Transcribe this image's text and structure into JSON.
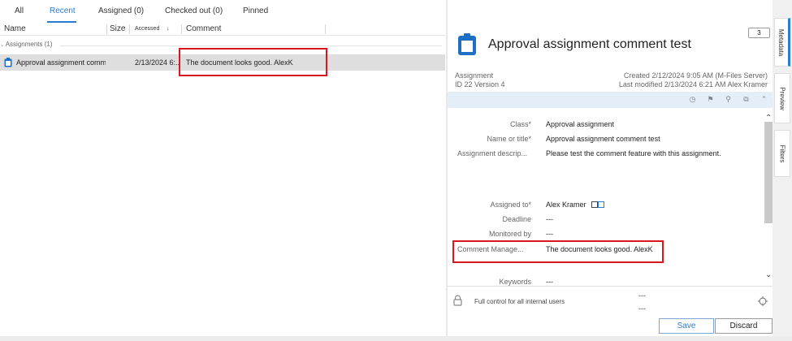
{
  "tabs": [
    {
      "label": "All"
    },
    {
      "label": "Recent"
    },
    {
      "label": "Assigned (0)"
    },
    {
      "label": "Checked out (0)"
    },
    {
      "label": "Pinned"
    }
  ],
  "active_tab": "Recent",
  "columns": {
    "name": "Name",
    "size": "Size",
    "accessed": "Accessed",
    "accessed_sort": "↓",
    "comment": "Comment"
  },
  "group": {
    "label": "Assignments (1)"
  },
  "row": {
    "name": "Approval assignment comm...",
    "accessed": "2/13/2024 6:...",
    "comment": "The document looks good. AlexK"
  },
  "details": {
    "title": "Approval assignment comment test",
    "comment_count": "3",
    "object_type": "Assignment",
    "id_version": "ID 22  Version 4",
    "created": "Created 2/12/2024 9:05 AM (M-Files Server)",
    "last_modified": "Last modified 2/13/2024 6:21 AM Alex Kramer",
    "properties": [
      {
        "label": "Class*",
        "value": "Approval assignment"
      },
      {
        "label": "Name or title*",
        "value": "Approval assignment comment test"
      },
      {
        "label": "Assignment descrip...",
        "value": "Please test the comment feature with this assignment."
      },
      {
        "label": "Assigned to*",
        "value": "Alex Kramer"
      },
      {
        "label": "Deadline",
        "value": "---"
      },
      {
        "label": "Monitored by",
        "value": "---"
      },
      {
        "label": "Comment Manage...",
        "value": "The document looks good. AlexK"
      },
      {
        "label": "Keywords",
        "value": "---"
      }
    ],
    "permissions": "Full control for all internal users",
    "dash_1": "---",
    "dash_2": "---",
    "save_label": "Save",
    "discard_label": "Discard"
  },
  "side_tabs": [
    {
      "label": "Metadata"
    },
    {
      "label": "Preview"
    },
    {
      "label": "Filters"
    }
  ],
  "colors": {
    "accent": "#2b7bd0",
    "highlight": "#d7191f",
    "selected_row": "#dedede"
  }
}
